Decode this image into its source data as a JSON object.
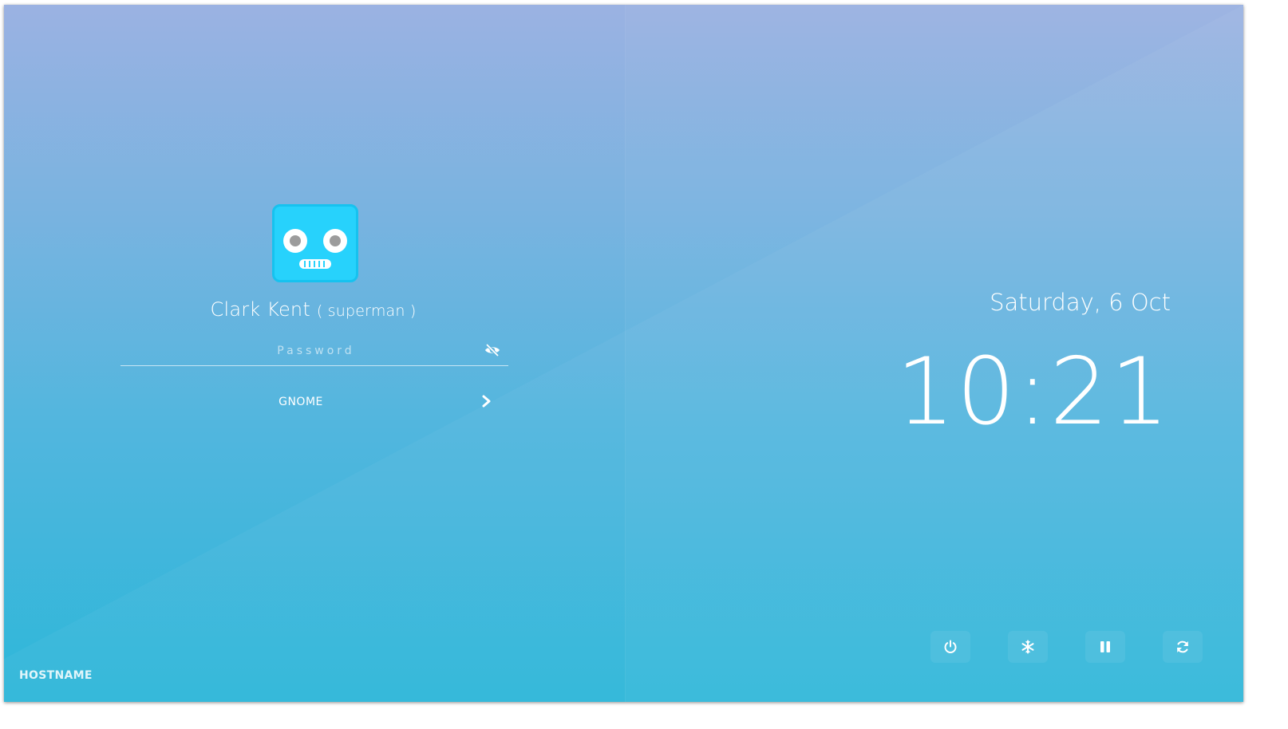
{
  "user": {
    "full_name": "Clark Kent",
    "username": "( superman )",
    "avatar_icon": "robot-face-icon"
  },
  "password": {
    "placeholder": "Password",
    "value": "",
    "toggle_icon": "eye-slash-icon"
  },
  "session": {
    "name": "GNOME",
    "next_icon": "chevron-right-icon"
  },
  "hostname": "HOSTNAME",
  "datetime": {
    "date": "Saturday, 6 Oct",
    "time": "10:21"
  },
  "power_actions": [
    {
      "icon": "power-icon"
    },
    {
      "icon": "snowflake-icon"
    },
    {
      "icon": "pause-icon"
    },
    {
      "icon": "refresh-icon"
    }
  ],
  "colors": {
    "background_top": "#9bb2e2",
    "background_bottom": "#2db7d9",
    "avatar": "#27d2fc",
    "text": "#ffffff"
  }
}
